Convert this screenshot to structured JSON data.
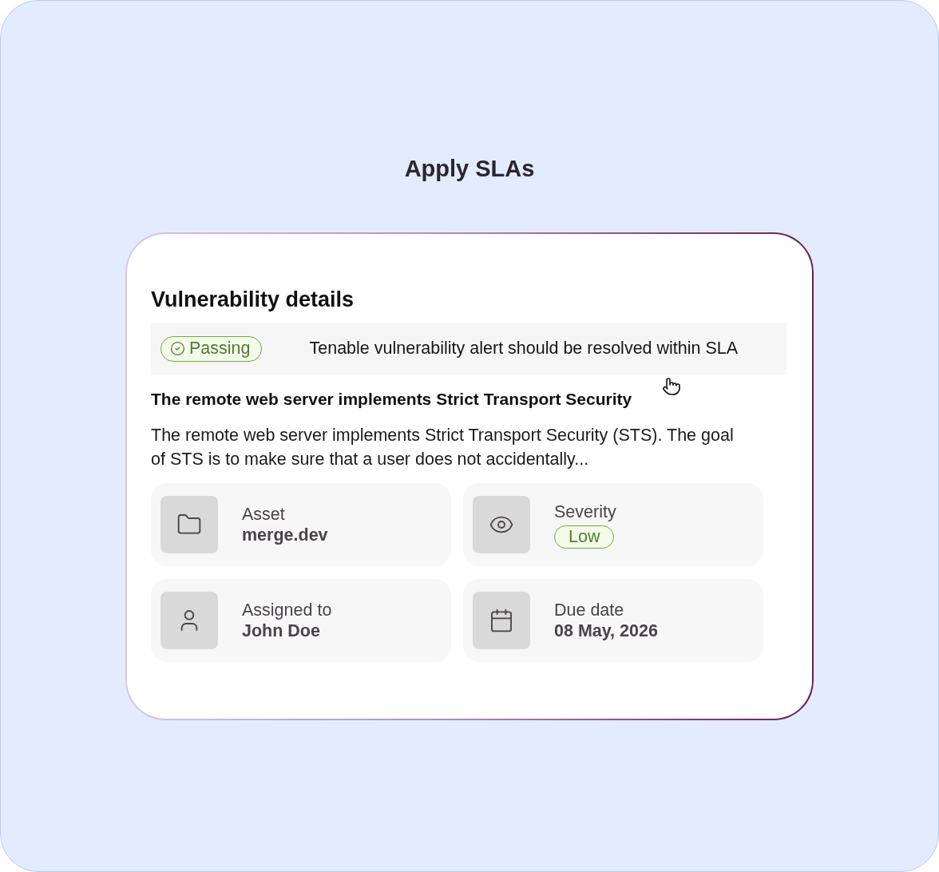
{
  "title": "Apply SLAs",
  "card": {
    "title": "Vulnerability details",
    "status": {
      "badge": "Passing",
      "kind": "passing",
      "message": "Tenable vulnerability alert should be resolved within SLA"
    },
    "finding": {
      "title": "The remote web server implements Strict Transport Security",
      "description": "The remote web server implements Strict Transport Security (STS). The goal of STS is to make sure that a user does not accidentally..."
    },
    "fields": [
      {
        "kind": "asset",
        "label": "Asset",
        "value": "merge.dev"
      },
      {
        "kind": "severity",
        "label": "Severity",
        "value": "Low"
      },
      {
        "kind": "assignee",
        "label": "Assigned to",
        "value": "John Doe"
      },
      {
        "kind": "due_date",
        "label": "Due date",
        "value": "08 May, 2026"
      }
    ]
  }
}
